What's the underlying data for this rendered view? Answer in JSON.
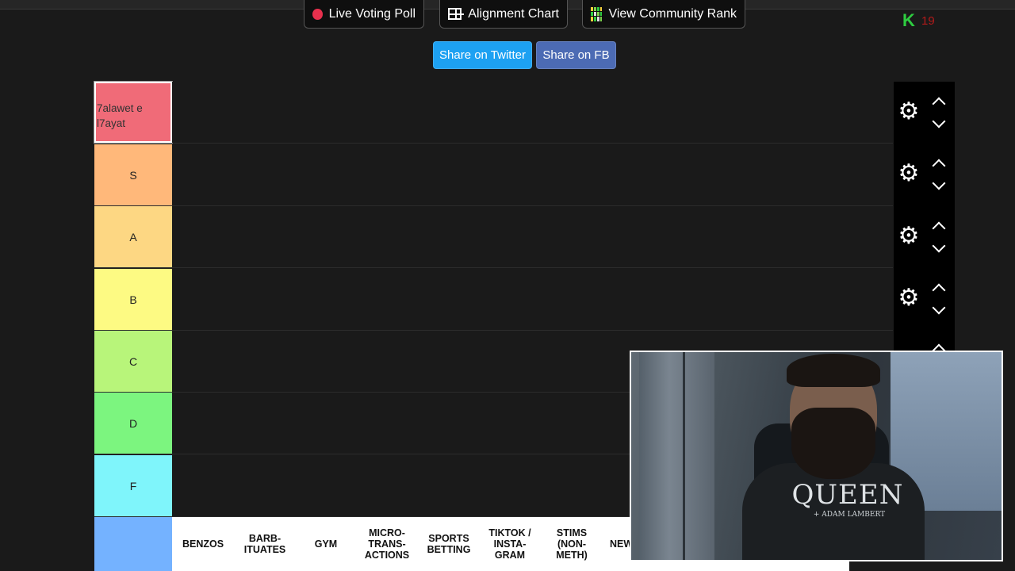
{
  "toolbar": {
    "buttons": [
      {
        "label": "Live Voting Poll",
        "icon": "record-dot-icon"
      },
      {
        "label": "Alignment Chart",
        "icon": "grid-icon"
      },
      {
        "label": "View Community Rank",
        "icon": "community-rank-icon"
      }
    ],
    "badge_count": "19"
  },
  "share": {
    "twitter_label": "Share on Twitter",
    "fb_label": "Share on FB",
    "twitter_color": "#1da1f2",
    "fb_color": "#3b5998"
  },
  "tiers": [
    {
      "label": "7alawet e l7ayat",
      "color": "#ff7f7f"
    },
    {
      "label": "S",
      "color": "#ffbf7f"
    },
    {
      "label": "A",
      "color": "#ffdf7f"
    },
    {
      "label": "B",
      "color": "#ffff7f"
    },
    {
      "label": "C",
      "color": "#bfff7f"
    },
    {
      "label": "D",
      "color": "#7fff7f"
    },
    {
      "label": "F",
      "color": "#7fffff"
    }
  ],
  "pool": {
    "items": [
      "BENZOS",
      "BARB-\nITUATES",
      "GYM",
      "MICRO-\nTRANS-\nACTIONS",
      "SPORTS\nBETTING",
      "TIKTOK /\nINSTA-\nGRAM",
      "STIMS\n(NON-\nMETH)",
      "NEW"
    ]
  },
  "webcam": {
    "shirt_text": "QUEEN",
    "shirt_subtext": "+ ADAM LAMBERT"
  }
}
